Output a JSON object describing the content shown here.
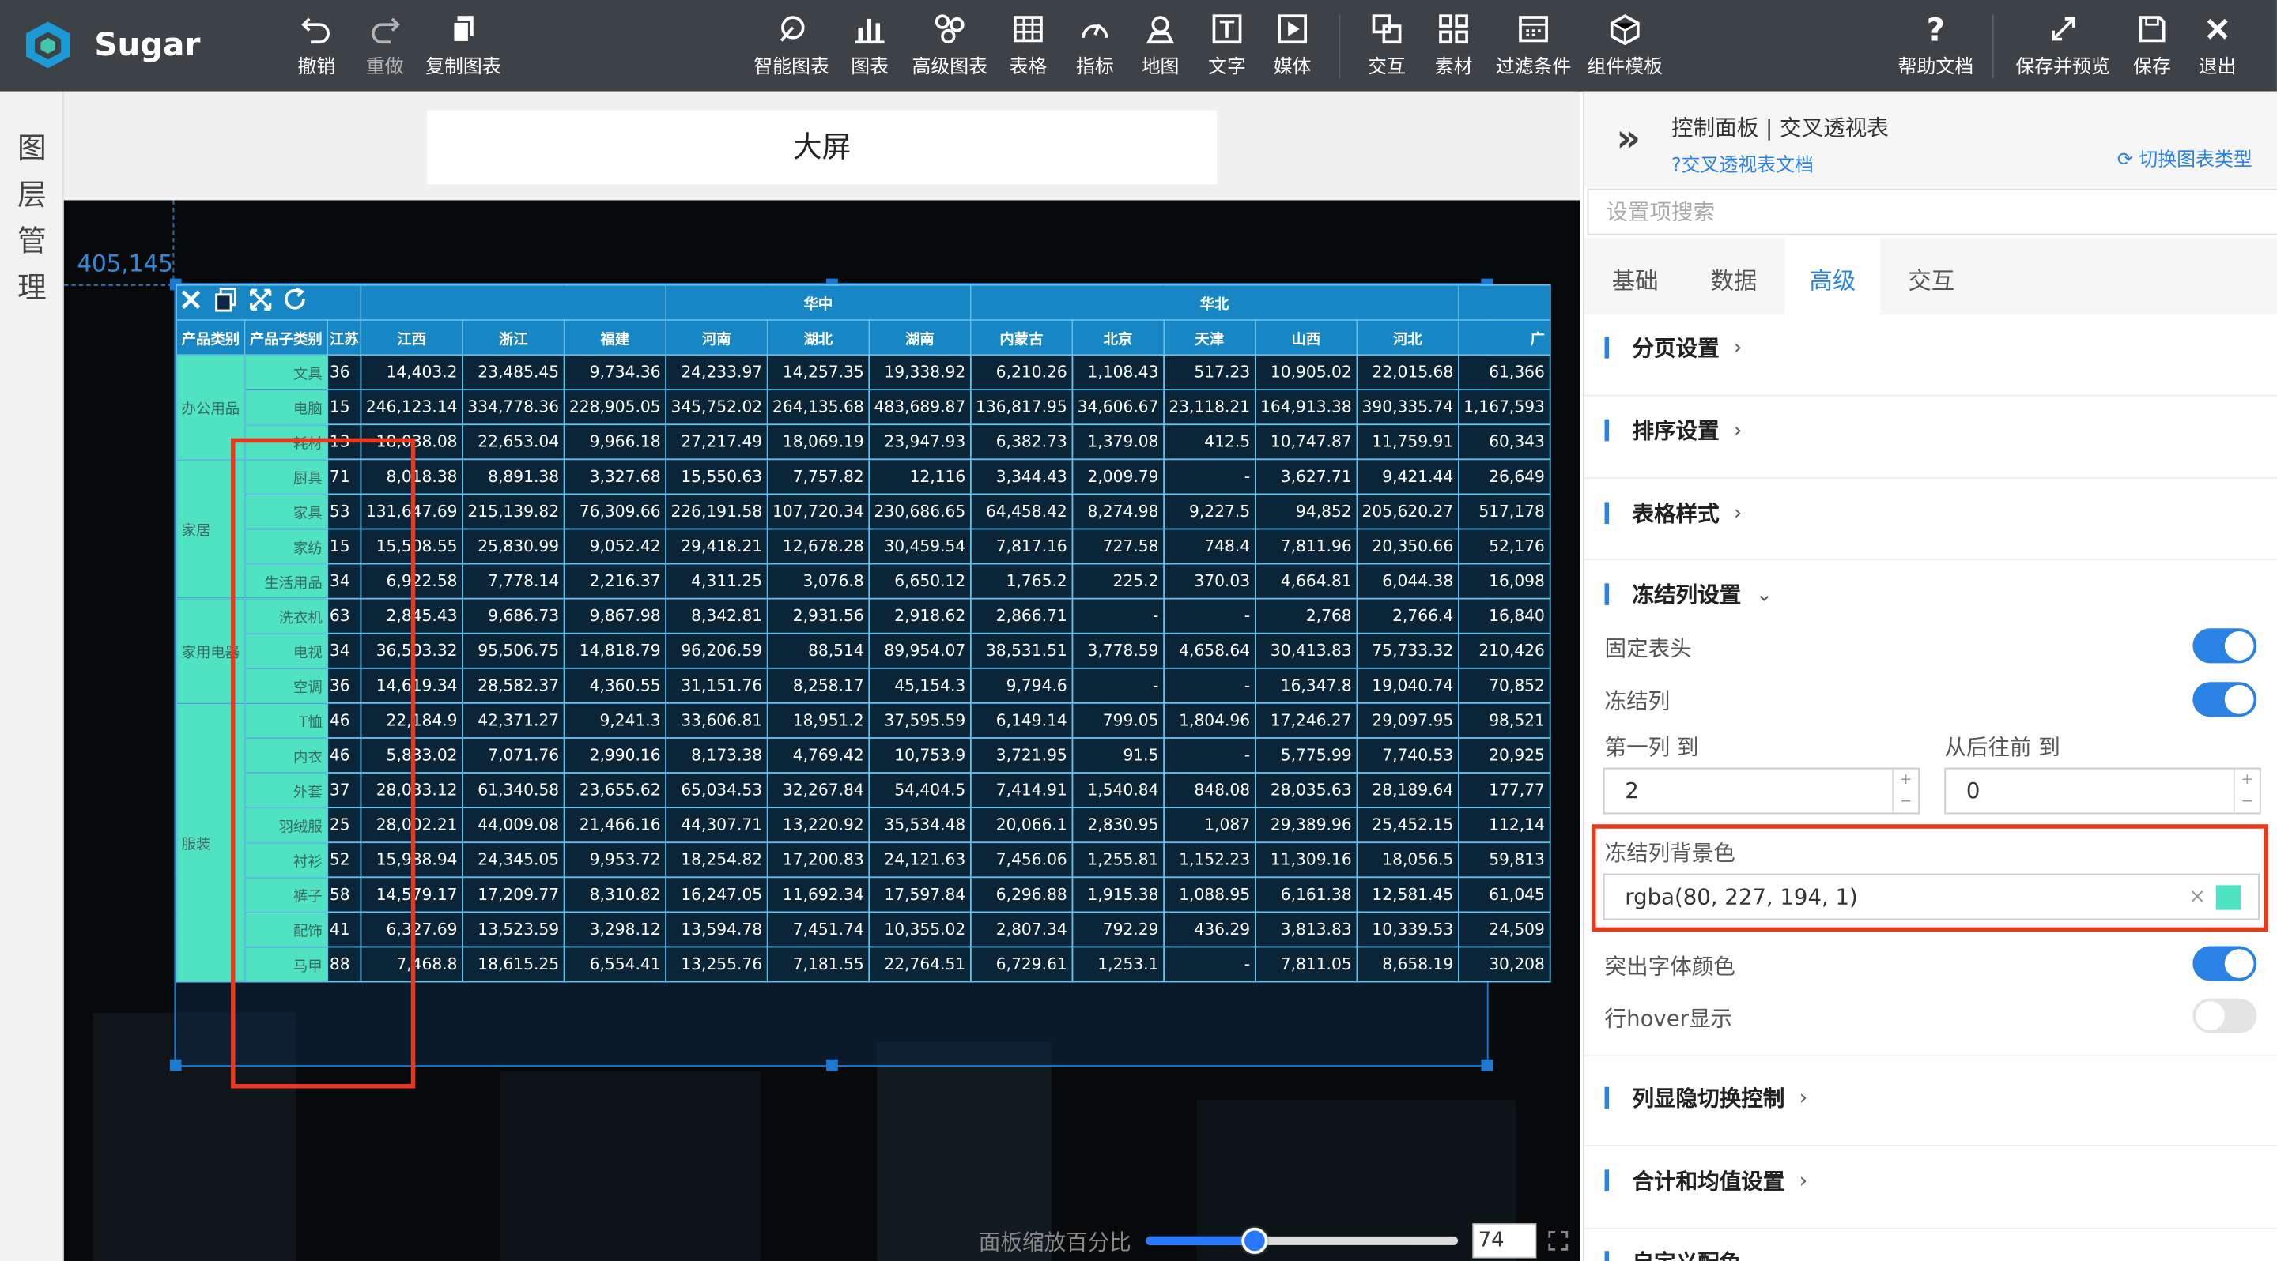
{
  "app": {
    "name": "Sugar"
  },
  "toolbar": {
    "undo": "撤销",
    "redo": "重做",
    "copy_chart": "复制图表",
    "smart_chart": "智能图表",
    "chart": "图表",
    "advanced_chart": "高级图表",
    "table": "表格",
    "metric": "指标",
    "map": "地图",
    "text": "文字",
    "media": "媒体",
    "interaction": "交互",
    "material": "素材",
    "filter": "过滤条件",
    "component_template": "组件模板",
    "help": "帮助文档",
    "save_preview": "保存并预览",
    "save": "保存",
    "exit": "退出"
  },
  "layer_panel": {
    "label": [
      "图",
      "层",
      "管",
      "理"
    ]
  },
  "canvas": {
    "title": "大屏",
    "coords": "405,145"
  },
  "zoom": {
    "label": "面板缩放百分比",
    "value": "74",
    "fraction": 0.35
  },
  "pivot": {
    "regions": [
      "华中",
      "华北"
    ],
    "row_headers": [
      "产品类别",
      "产品子类别"
    ],
    "columns": [
      "江苏",
      "江西",
      "浙江",
      "福建",
      "河南",
      "湖北",
      "湖南",
      "内蒙古",
      "北京",
      "天津",
      "山西",
      "河北",
      "广"
    ],
    "groups": [
      {
        "name": "办公用品",
        "rows": [
          {
            "sub": "文具",
            "vals": [
              "36",
              "14,403.2",
              "23,485.45",
              "9,734.36",
              "24,233.97",
              "14,257.35",
              "19,338.92",
              "6,210.26",
              "1,108.43",
              "517.23",
              "10,905.02",
              "22,015.68",
              "61,366"
            ]
          },
          {
            "sub": "电脑",
            "vals": [
              "15",
              "246,123.14",
              "334,778.36",
              "228,905.05",
              "345,752.02",
              "264,135.68",
              "483,689.87",
              "136,817.95",
              "34,606.67",
              "23,118.21",
              "164,913.38",
              "390,335.74",
              "1,167,593"
            ]
          },
          {
            "sub": "耗材",
            "vals": [
              "13",
              "18,038.08",
              "22,653.04",
              "9,966.18",
              "27,217.49",
              "18,069.19",
              "23,947.93",
              "6,382.73",
              "1,379.08",
              "412.5",
              "10,747.87",
              "11,759.91",
              "60,343"
            ]
          }
        ]
      },
      {
        "name": "家居",
        "rows": [
          {
            "sub": "厨具",
            "vals": [
              "71",
              "8,018.38",
              "8,891.38",
              "3,327.68",
              "15,550.63",
              "7,757.82",
              "12,116",
              "3,344.43",
              "2,009.79",
              "-",
              "3,627.71",
              "9,421.44",
              "26,649"
            ]
          },
          {
            "sub": "家具",
            "vals": [
              "53",
              "131,647.69",
              "215,139.82",
              "76,309.66",
              "226,191.58",
              "107,720.34",
              "230,686.65",
              "64,458.42",
              "8,274.98",
              "9,227.5",
              "94,852",
              "205,620.27",
              "517,178"
            ]
          },
          {
            "sub": "家纺",
            "vals": [
              "15",
              "15,508.55",
              "25,830.99",
              "9,052.42",
              "29,418.21",
              "12,678.28",
              "30,459.54",
              "7,817.16",
              "727.58",
              "748.4",
              "7,811.96",
              "20,350.66",
              "52,176"
            ]
          },
          {
            "sub": "生活用品",
            "vals": [
              "34",
              "6,922.58",
              "7,778.14",
              "2,216.37",
              "4,311.25",
              "3,076.8",
              "6,650.12",
              "1,765.2",
              "225.2",
              "370.03",
              "4,664.81",
              "6,044.38",
              "16,098"
            ]
          }
        ]
      },
      {
        "name": "家用电器",
        "rows": [
          {
            "sub": "洗衣机",
            "vals": [
              "63",
              "2,845.43",
              "9,686.73",
              "9,867.98",
              "8,342.81",
              "2,931.56",
              "2,918.62",
              "2,866.71",
              "-",
              "-",
              "2,768",
              "2,766.4",
              "16,840"
            ]
          },
          {
            "sub": "电视",
            "vals": [
              "34",
              "36,503.32",
              "95,506.75",
              "14,818.79",
              "96,206.59",
              "88,514",
              "89,954.07",
              "38,531.51",
              "3,778.59",
              "4,658.64",
              "30,413.83",
              "75,733.32",
              "210,426"
            ]
          },
          {
            "sub": "空调",
            "vals": [
              "36",
              "14,619.34",
              "28,582.37",
              "4,360.55",
              "31,151.76",
              "8,258.17",
              "45,154.3",
              "9,794.6",
              "-",
              "-",
              "16,347.8",
              "19,040.74",
              "70,852"
            ]
          }
        ]
      },
      {
        "name": "服装",
        "rows": [
          {
            "sub": "T恤",
            "vals": [
              "46",
              "22,184.9",
              "42,371.27",
              "9,241.3",
              "33,606.81",
              "18,951.2",
              "37,595.59",
              "6,149.14",
              "799.05",
              "1,804.96",
              "17,246.27",
              "29,097.95",
              "98,521"
            ]
          },
          {
            "sub": "内衣",
            "vals": [
              "46",
              "5,833.02",
              "7,071.76",
              "2,990.16",
              "8,173.38",
              "4,769.42",
              "10,753.9",
              "3,721.95",
              "91.5",
              "-",
              "5,775.99",
              "7,740.53",
              "20,925"
            ]
          },
          {
            "sub": "外套",
            "vals": [
              "37",
              "28,033.12",
              "61,340.58",
              "23,655.62",
              "65,034.53",
              "32,267.84",
              "54,404.5",
              "7,414.91",
              "1,540.84",
              "848.08",
              "28,035.63",
              "28,189.64",
              "177,77"
            ]
          },
          {
            "sub": "羽绒服",
            "vals": [
              "25",
              "28,002.21",
              "44,009.08",
              "21,466.16",
              "44,307.71",
              "13,220.92",
              "35,534.48",
              "20,066.1",
              "2,830.95",
              "1,087",
              "29,389.96",
              "25,452.15",
              "112,14"
            ]
          },
          {
            "sub": "衬衫",
            "vals": [
              "52",
              "15,988.94",
              "24,345.05",
              "9,953.72",
              "18,254.82",
              "17,200.83",
              "24,121.63",
              "7,456.06",
              "1,255.81",
              "1,152.23",
              "11,309.16",
              "18,056.5",
              "59,813"
            ]
          },
          {
            "sub": "裤子",
            "vals": [
              "58",
              "14,579.17",
              "17,209.77",
              "8,310.82",
              "16,247.05",
              "11,692.34",
              "17,597.84",
              "6,296.88",
              "1,915.38",
              "1,088.95",
              "6,161.38",
              "12,581.45",
              "61,045"
            ]
          },
          {
            "sub": "配饰",
            "vals": [
              "41",
              "6,327.69",
              "13,523.59",
              "3,298.12",
              "13,594.78",
              "7,451.74",
              "10,355.02",
              "2,807.34",
              "792.29",
              "436.29",
              "3,813.83",
              "10,339.53",
              "24,509"
            ]
          },
          {
            "sub": "马甲",
            "vals": [
              "88",
              "7,468.8",
              "18,615.25",
              "6,554.41",
              "13,255.76",
              "7,181.55",
              "22,764.51",
              "6,729.61",
              "1,253.1",
              "-",
              "7,811.05",
              "8,658.19",
              "30,208"
            ]
          }
        ]
      }
    ]
  },
  "panel": {
    "title": "控制面板 | 交叉透视表",
    "doc_link": "交叉透视表文档",
    "switch_type": "切换图表类型",
    "search_placeholder": "设置项搜索",
    "tabs": [
      "基础",
      "数据",
      "高级",
      "交互"
    ],
    "active_tab": "高级",
    "sections": {
      "paging": "分页设置",
      "sorting": "排序设置",
      "table_style": "表格样式",
      "freeze": "冻结列设置",
      "col_toggle": "列显隐切换控制",
      "total_avg": "合计和均值设置",
      "custom_color": "自定义配色"
    },
    "freeze": {
      "fixed_header": "固定表头",
      "fixed_header_on": true,
      "freeze_col": "冻结列",
      "freeze_col_on": true,
      "first_col_label": "第一列 到",
      "first_col_value": "2",
      "from_back_label": "从后往前 到",
      "from_back_value": "0",
      "bg_label": "冻结列背景色",
      "bg_value": "rgba(80, 227, 194, 1)",
      "bg_color": "#50e3c2"
    },
    "highlight_font": "突出字体颜色",
    "highlight_font_on": true,
    "row_hover": "行hover显示",
    "row_hover_on": false
  },
  "colors": {
    "accent": "#2a82e4",
    "topbar": "#3d4246",
    "freeze_bg": "#50e3c2",
    "highlight_box": "#e8391c"
  }
}
